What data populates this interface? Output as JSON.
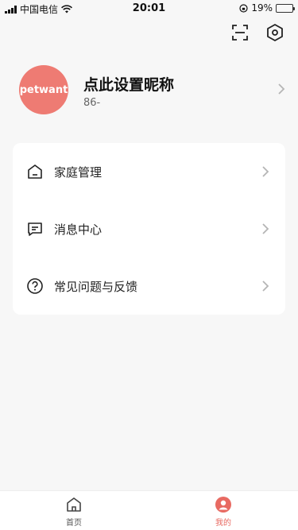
{
  "status_bar": {
    "carrier": "中国电信",
    "time": "20:01",
    "battery_percent": "19%",
    "battery_level": 0.19
  },
  "top_actions": {
    "scan_icon": "scan-icon",
    "settings_icon": "settings-hexagon-icon"
  },
  "profile": {
    "avatar_text": "petwant",
    "nickname": "点此设置昵称",
    "phone": "86-"
  },
  "menu": {
    "items": [
      {
        "label": "家庭管理",
        "icon": "home-outline-icon"
      },
      {
        "label": "消息中心",
        "icon": "message-icon"
      },
      {
        "label": "常见问题与反馈",
        "icon": "help-circle-icon"
      }
    ]
  },
  "tab_bar": {
    "tabs": [
      {
        "label": "首页",
        "icon": "home-icon"
      },
      {
        "label": "我的",
        "icon": "user-icon"
      }
    ],
    "accent": "#e86a62"
  }
}
